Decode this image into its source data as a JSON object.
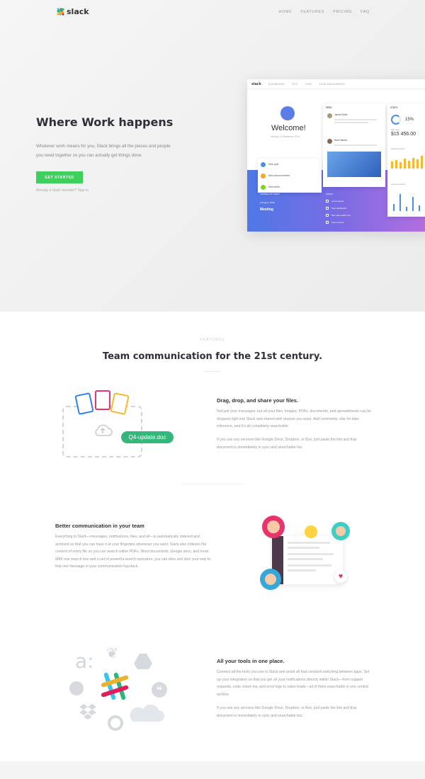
{
  "brand": {
    "name": "slack"
  },
  "nav": {
    "items": [
      "HOME",
      "FEATURES",
      "PRICING",
      "FAQ"
    ]
  },
  "hero": {
    "title": "Where Work happens",
    "subtitle": "Whatever work means for you, Slack brings all the pieces and people you need together so you can actually get things done.",
    "cta": "GET STARTED",
    "signin": "Already a Slack member? Sign in"
  },
  "dashboard": {
    "logo": "slack",
    "tabs": [
      "DASHBOARD",
      "TEST",
      "CHAT",
      "TEAM MANAGEMENT"
    ],
    "welcome": "Welcome!",
    "date": "Monday, 16 September 2016",
    "menu": [
      {
        "label": "New post",
        "color": "#4a90e2"
      },
      {
        "label": "New announcement",
        "color": "#f5a623"
      },
      {
        "label": "New event",
        "color": "#7ed321"
      }
    ],
    "feed_title": "FEED",
    "feed_users": [
      "James Smith",
      "Nina Hansen"
    ],
    "stats_title": "STATS",
    "stats_pct": "15%",
    "stats_earn_label": "Earnings",
    "stats_earn": "$15 456.00",
    "weekly_label": "Weekly growth",
    "active_label": "Active sessions",
    "upcoming_label": "COMING UP TODAY",
    "meeting_time": "9 August, 19:00",
    "meeting_title": "Meeting",
    "tasks_label": "TASKS",
    "tasks": [
      "Lorem ipsum",
      "Task dashboard",
      "Mer turtle sadhe est",
      "Lorem ipsum"
    ]
  },
  "features": {
    "kicker": "FEATURES",
    "title": "Team communication for the 21st century.",
    "items": [
      {
        "title": "Drag, drop, and share your files.",
        "p1": "Not just your messages, but all your files, images, PDFs, documents, and spreadsheets can be dropped right into Slack and shared with anyone you want. Add comments, star for later reference, and it's all completely searchable.",
        "p2": "If you use any services like Google Drive, Dropbox, or Box, just paste the link and that document is immediately in sync and searchable too.",
        "file_pill": "Q4-update.doc"
      },
      {
        "title": "Better communication in your team",
        "p1": "Everything in Slack—messages, notifications, files, and all—is automatically indexed and archived so that you can have it at your fingertips whenever you want. Slack also indexes the content of every file so you can search within PDFs, Word documents, Google docs, and more. With one search box and a set of powerful search operators, you can slice and dice your way to that one message in your communication haystack."
      },
      {
        "title": "All your tools in one place.",
        "p1": "Connect all the tools you use to Slack and avoid all that constant switching between apps. Set up your integration so that you get all your notifications directly within Slack—from support requests, code check-ins, and error logs to sales leads—all of them searchable in one central archive.",
        "p2": "If you use any services like Google Drive, Dropbox, or Box, just paste the link and that document is immediately in sync and searchable too."
      }
    ]
  },
  "colors": {
    "accent": "#3ecf5c",
    "heading": "#2f2f3a",
    "body_text": "#999999"
  }
}
